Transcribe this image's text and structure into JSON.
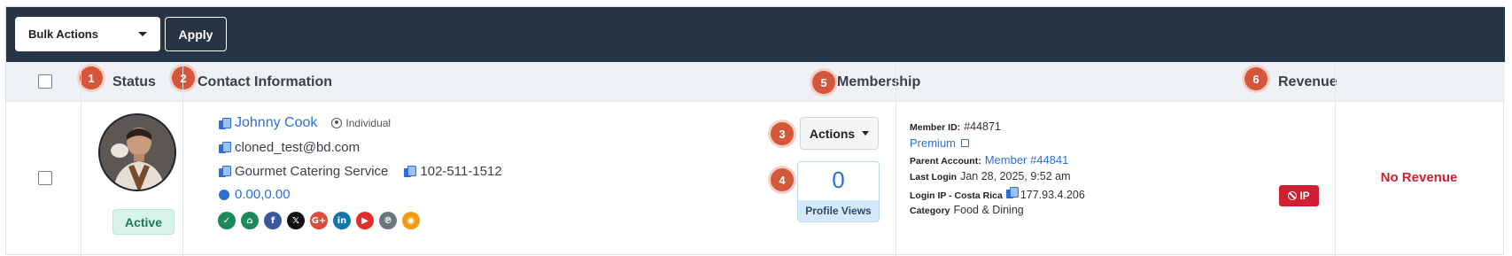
{
  "toolbar": {
    "bulk_actions_label": "Bulk Actions",
    "apply_label": "Apply"
  },
  "header": {
    "status": "Status",
    "contact": "Contact Information",
    "membership": "Membership",
    "revenue": "Revenue",
    "markers": [
      "1",
      "2",
      "3",
      "4",
      "5",
      "6"
    ]
  },
  "row": {
    "status": "Active",
    "contact": {
      "name": "Johnny Cook",
      "type": "Individual",
      "email": "cloned_test@bd.com",
      "company": "Gourmet Catering Service",
      "phone": "102-511-1512",
      "coordinates": "0.00,0.00",
      "social": [
        {
          "icon": "check-icon",
          "glyph": "✓",
          "color": "#1b8a5a"
        },
        {
          "icon": "home-icon",
          "glyph": "⌂",
          "color": "#1b8a5a"
        },
        {
          "icon": "facebook-icon",
          "glyph": "f",
          "color": "#3b5998"
        },
        {
          "icon": "x-icon",
          "glyph": "𝕏",
          "color": "#111111"
        },
        {
          "icon": "google-plus-icon",
          "glyph": "G+",
          "color": "#dd4b39"
        },
        {
          "icon": "linkedin-icon",
          "glyph": "in",
          "color": "#0e76a8"
        },
        {
          "icon": "youtube-icon",
          "glyph": "▶",
          "color": "#e52d27"
        },
        {
          "icon": "pinterest-icon",
          "glyph": "℗",
          "color": "#6c757d"
        },
        {
          "icon": "rss-icon",
          "glyph": "◉",
          "color": "#f39c12"
        }
      ]
    },
    "actions_label": "Actions",
    "profile_views": "0",
    "profile_views_label": "Profile Views",
    "membership": {
      "member_id_label": "Member ID:",
      "member_id": "#44871",
      "plan": "Premium",
      "parent_label": "Parent Account:",
      "parent": "Member #44841",
      "last_login_label": "Last Login",
      "last_login": "Jan 28, 2025, 9:52 am",
      "login_ip_label": "Login IP - Costa Rica",
      "login_ip": "177.93.4.206",
      "category_label": "Category",
      "category": "Food & Dining"
    },
    "ip_button": "IP",
    "revenue": "No Revenue"
  },
  "colors": {
    "toolbar_bg": "#263445",
    "link": "#2d6fd6",
    "marker": "#d5573b",
    "danger": "#cf1f31",
    "active_badge": "#d7f3ea"
  }
}
